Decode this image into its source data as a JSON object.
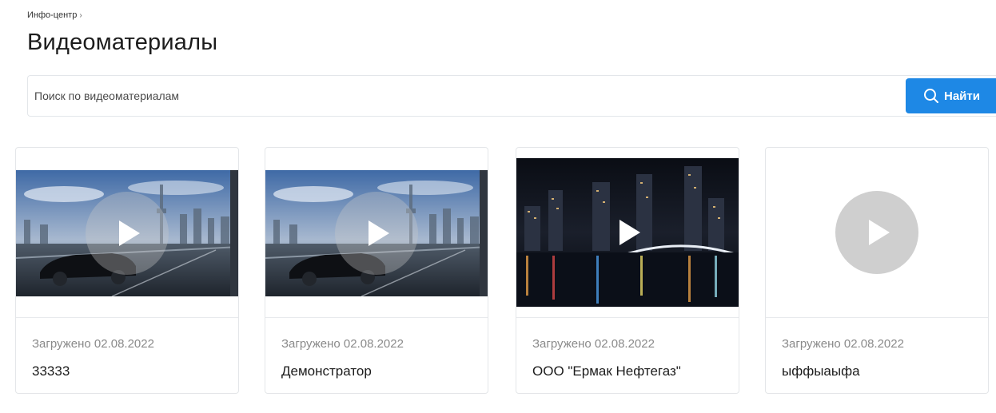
{
  "breadcrumb": {
    "items": [
      "Инфо-центр"
    ],
    "separator": "›"
  },
  "page": {
    "title": "Видеоматериалы"
  },
  "search": {
    "placeholder": "Поиск по видеоматериалам",
    "value": "",
    "button_label": "Найти",
    "button_icon": "search-icon",
    "accent_color": "#1e88e5"
  },
  "videos": [
    {
      "uploaded": "Загружено 02.08.2022",
      "title": "33333",
      "thumbnail": "city-car-photo"
    },
    {
      "uploaded": "Загружено 02.08.2022",
      "title": "Демонстратор",
      "thumbnail": "city-car-photo"
    },
    {
      "uploaded": "Загружено 02.08.2022",
      "title": "ООО \"Ермак Нефтегаз\"",
      "thumbnail": "night-city-photo"
    },
    {
      "uploaded": "Загружено 02.08.2022",
      "title": "ыффыаыфа",
      "thumbnail": "placeholder"
    }
  ]
}
